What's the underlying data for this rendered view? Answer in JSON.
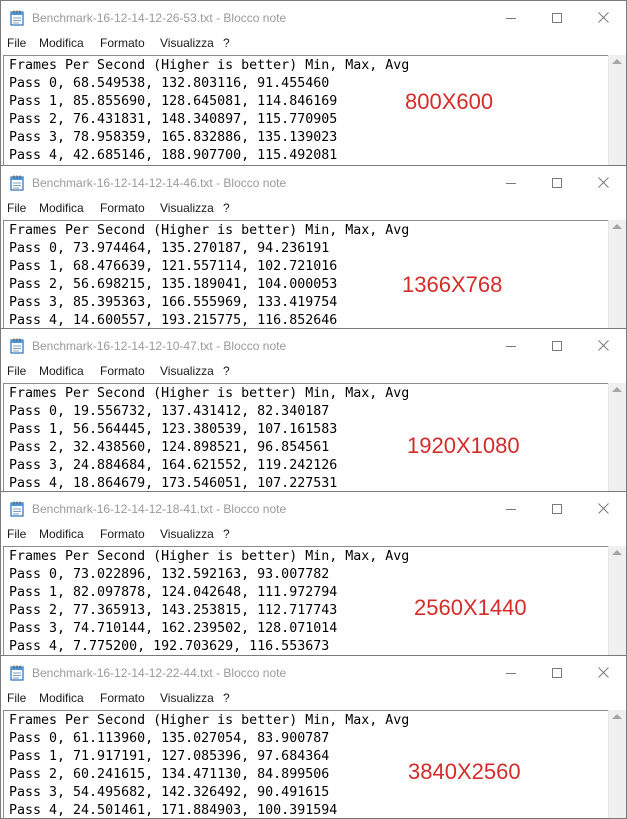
{
  "menu": [
    "File",
    "Modifica",
    "Formato",
    "Visualizza",
    "?"
  ],
  "windows": [
    {
      "title": "Benchmark-16-12-14-12-26-53.txt - Blocco note",
      "resolution": "800X600",
      "lines": [
        "Frames Per Second (Higher is better) Min, Max, Avg",
        "Pass 0, 68.549538, 132.803116, 91.455460",
        "Pass 1, 85.855690, 128.645081, 114.846169",
        "Pass 2, 76.431831, 148.340897, 115.770905",
        "Pass 3, 78.958359, 165.832886, 135.139023",
        "Pass 4, 42.685146, 188.907700, 115.492081"
      ]
    },
    {
      "title": "Benchmark-16-12-14-12-14-46.txt - Blocco note",
      "resolution": "1366X768",
      "lines": [
        "Frames Per Second (Higher is better) Min, Max, Avg",
        "Pass 0, 73.974464, 135.270187, 94.236191",
        "Pass 1, 68.476639, 121.557114, 102.721016",
        "Pass 2, 56.698215, 135.189041, 104.000053",
        "Pass 3, 85.395363, 166.555969, 133.419754",
        "Pass 4, 14.600557, 193.215775, 116.852646"
      ]
    },
    {
      "title": "Benchmark-16-12-14-12-10-47.txt - Blocco note",
      "resolution": "1920X1080",
      "lines": [
        "Frames Per Second (Higher is better) Min, Max, Avg",
        "Pass 0, 19.556732, 137.431412, 82.340187",
        "Pass 1, 56.564445, 123.380539, 107.161583",
        "Pass 2, 32.438560, 124.898521, 96.854561",
        "Pass 3, 24.884684, 164.621552, 119.242126",
        "Pass 4, 18.864679, 173.546051, 107.227531"
      ]
    },
    {
      "title": "Benchmark-16-12-14-12-18-41.txt - Blocco note",
      "resolution": "2560X1440",
      "lines": [
        "Frames Per Second (Higher is better) Min, Max, Avg",
        "Pass 0, 73.022896, 132.592163, 93.007782",
        "Pass 1, 82.097878, 124.042648, 111.972794",
        "Pass 2, 77.365913, 143.253815, 112.717743",
        "Pass 3, 74.710144, 162.239502, 128.071014",
        "Pass 4, 7.775200, 192.703629, 116.553673"
      ]
    },
    {
      "title": "Benchmark-16-12-14-12-22-44.txt - Blocco note",
      "resolution": "3840X2560",
      "lines": [
        "Frames Per Second (Higher is better) Min, Max, Avg",
        "Pass 0, 61.113960, 135.027054, 83.900787",
        "Pass 1, 71.917191, 127.085396, 97.684364",
        "Pass 2, 60.241615, 134.471130, 84.899506",
        "Pass 3, 54.495682, 142.326492, 90.491615",
        "Pass 4, 24.501461, 171.884903, 100.391594"
      ]
    }
  ],
  "colors": {
    "resolution_label": "#d42b2b",
    "title_text": "#9a9a9a"
  }
}
